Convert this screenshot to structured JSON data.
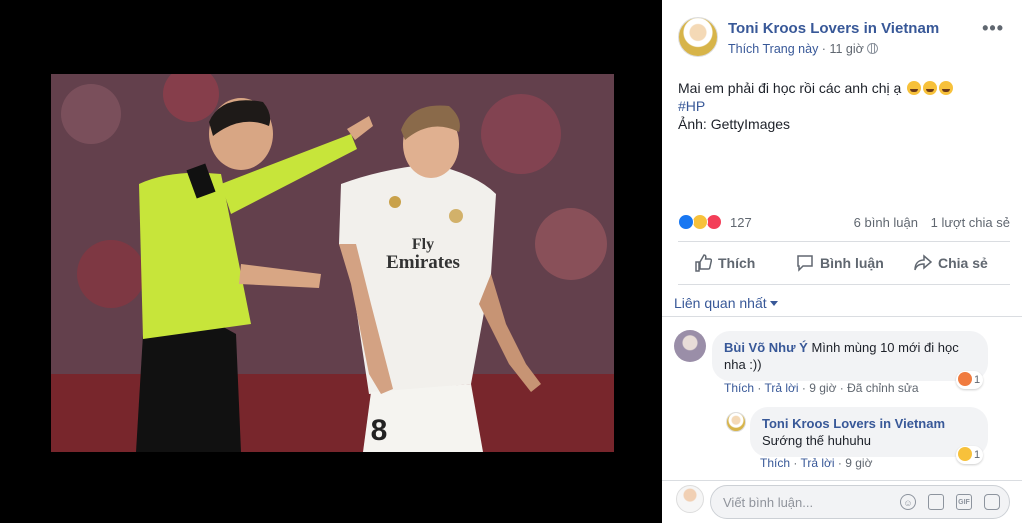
{
  "post": {
    "page_name": "Toni Kroos Lovers in Vietnam",
    "like_page_label": "Thích Trang này",
    "separator": " · ",
    "time": "11 giờ",
    "text": "Mai em phải đi học rồi các anh chị ạ",
    "hashtag": "#HP",
    "credit": "Ảnh: GettyImages",
    "reaction_count": "127",
    "comments_count": "6 bình luận",
    "shares_count": "1 lượt chia sẻ"
  },
  "photo": {
    "jersey_sponsor_line1": "Fly",
    "jersey_sponsor_line2": "Emirates",
    "jersey_number": "8"
  },
  "actions": {
    "like": "Thích",
    "comment": "Bình luận",
    "share": "Chia sẻ"
  },
  "sort_label": "Liên quan nhất",
  "comments": [
    {
      "author": "Bùi Võ Như Ý",
      "text": "Mình mùng 10 mới đi học nha :))",
      "like": "Thích",
      "reply": "Trả lời",
      "time": "9 giờ",
      "edited": "Đã chỉnh sửa",
      "reaction_count": "1",
      "reaction_icon": "angry-icon"
    },
    {
      "author": "Toni Kroos Lovers in Vietnam",
      "text": "Sướng thế huhuhu",
      "like": "Thích",
      "reply": "Trả lời",
      "time": "9 giờ",
      "reaction_count": "1",
      "reaction_icon": "haha-icon"
    }
  ],
  "composer": {
    "placeholder": "Viết bình luận..."
  },
  "colors": {
    "link": "#385898",
    "secondary_text": "#606770",
    "referee_shirt": "#c7e53a",
    "like_blue": "#1877f2",
    "love_red": "#f33e58",
    "haha_yellow": "#f7c13b"
  }
}
